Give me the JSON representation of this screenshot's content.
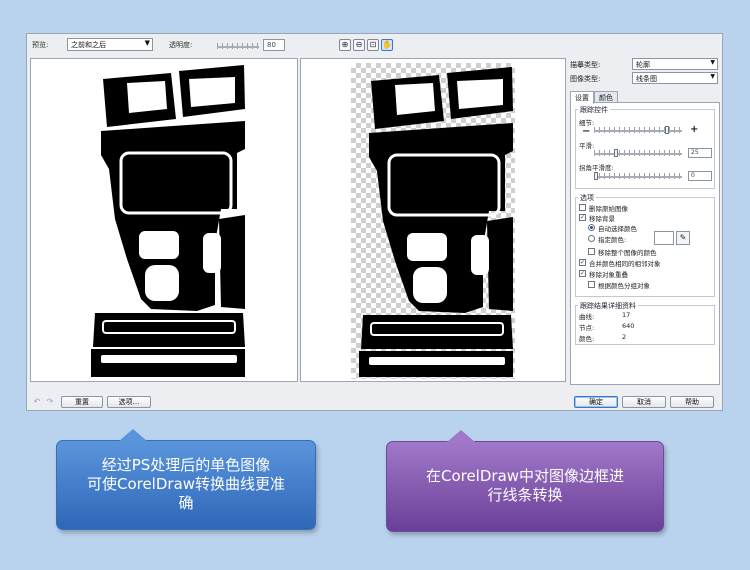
{
  "toolbar": {
    "preview_label": "预览:",
    "preview_value": "之前和之后",
    "transparency_label": "透明度:",
    "transparency_value": "80"
  },
  "zoom_buttons": [
    {
      "icon": "zoom-in-icon",
      "glyph": "⊕"
    },
    {
      "icon": "zoom-out-icon",
      "glyph": "⊖"
    },
    {
      "icon": "fit-icon",
      "glyph": "⊡"
    },
    {
      "icon": "pan-icon",
      "glyph": "✋"
    }
  ],
  "settings": {
    "trace_type_label": "描摹类型:",
    "trace_type_value": "轮廓",
    "image_type_label": "图像类型:",
    "image_type_value": "线条图"
  },
  "tabs": [
    "设置",
    "颜色"
  ],
  "trace_controls": {
    "title": "跟踪控件",
    "detail_label": "细节:",
    "detail_level": 0.82,
    "smoothing_label": "平滑:",
    "smoothing_value": "25",
    "corner_label": "拐角平滑度:",
    "corner_value": "0"
  },
  "options": {
    "title": "选项",
    "delete_original": {
      "label": "删除原始图像",
      "checked": false
    },
    "remove_background": {
      "label": "移除背景",
      "checked": true
    },
    "auto_color": {
      "label": "自动选择颜色",
      "selected": true
    },
    "specify_color": {
      "label": "指定颜色:",
      "selected": false
    },
    "remove_whole_image_color": {
      "label": "移除整个图像的颜色",
      "checked": false
    },
    "merge_adjacent": {
      "label": "合并颜色相同的相邻对象",
      "checked": true
    },
    "remove_overlap": {
      "label": "移除对象重叠",
      "checked": true
    },
    "group_by_color": {
      "label": "根据颜色分组对象",
      "checked": false
    }
  },
  "results": {
    "title": "跟踪结果详细资料",
    "curves_label": "曲线:",
    "curves_value": "17",
    "nodes_label": "节点:",
    "nodes_value": "640",
    "colors_label": "颜色:",
    "colors_value": "2"
  },
  "buttons": {
    "reset": "重置",
    "options": "选项...",
    "ok": "确定",
    "cancel": "取消",
    "help": "帮助"
  },
  "callouts": {
    "left_lines": [
      "经过PS处理后的单色图像",
      "可使CorelDraw转换曲线更准",
      "确"
    ],
    "right_lines": [
      "在CorelDraw中对图像边框进",
      "行线条转换"
    ]
  }
}
